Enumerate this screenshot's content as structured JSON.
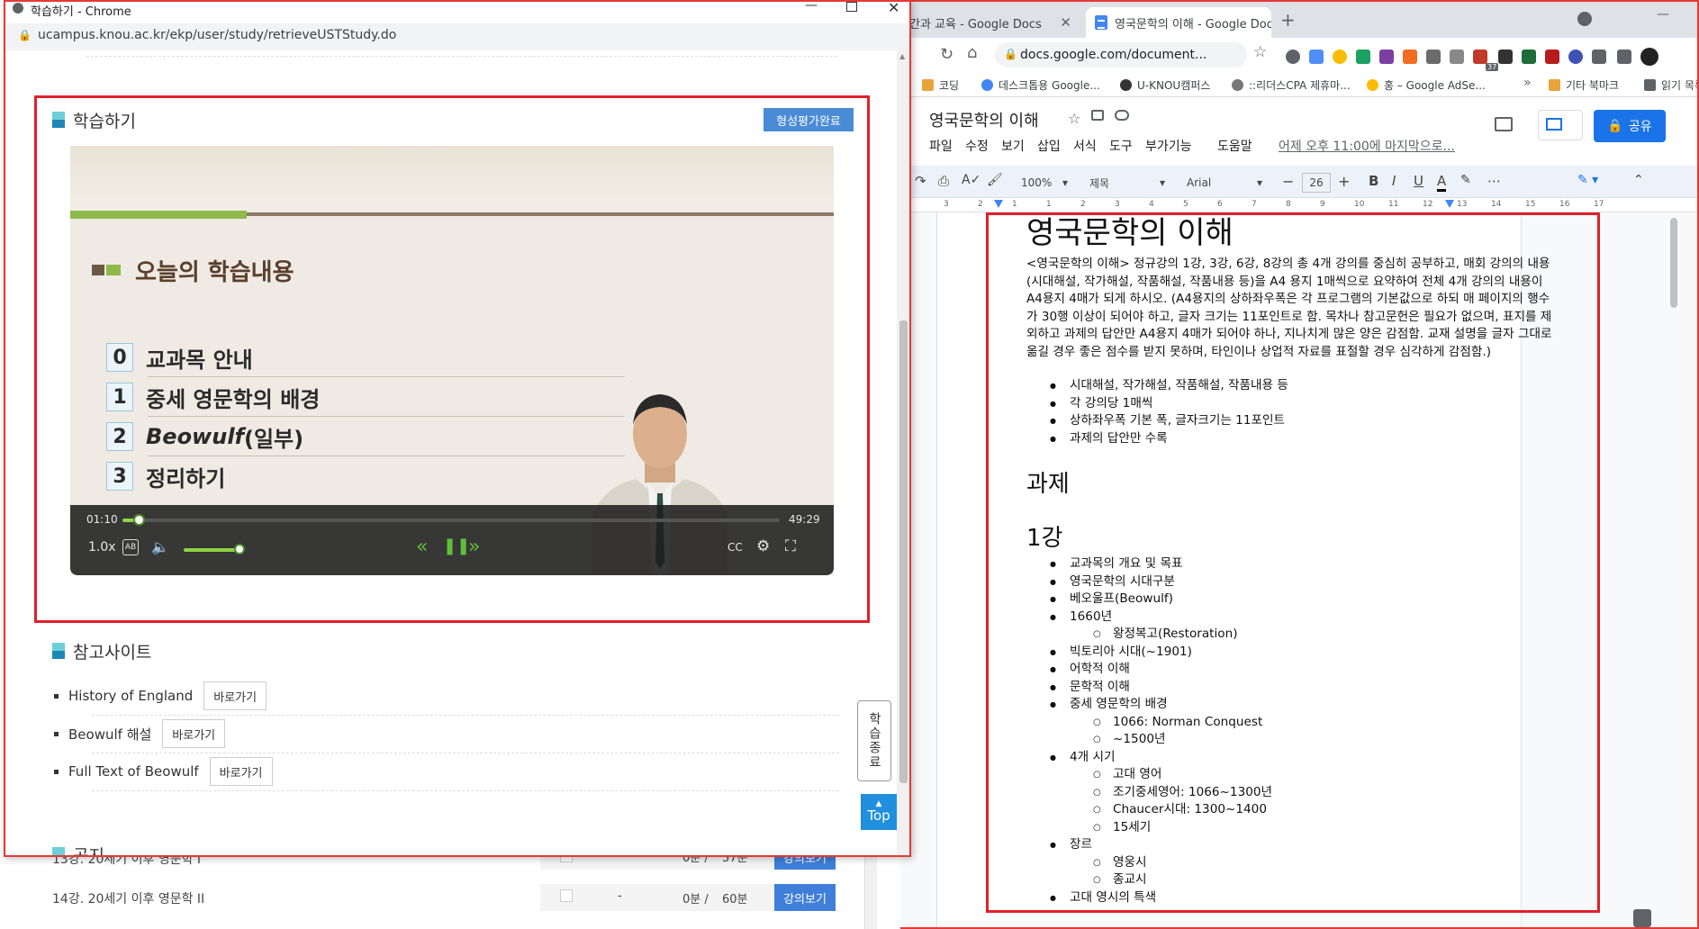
{
  "popup": {
    "title": "학습하기 - Chrome",
    "url": "ucampus.knou.ac.kr/ekp/user/study/retrieveUSTStudy.do",
    "study_section_title": "학습하기",
    "done_button": "형성평가완료",
    "slide": {
      "heading": "오늘의 학습내용",
      "items": [
        {
          "num": "0",
          "label": "교과목 안내"
        },
        {
          "num": "1",
          "label": "중세 영문학의 배경"
        },
        {
          "num": "2",
          "label_italic": "Beowulf",
          "label": " (일부)"
        },
        {
          "num": "3",
          "label": "정리하기"
        }
      ]
    },
    "player": {
      "current_time": "01:10",
      "duration": "49:29",
      "progress": 0.024,
      "speed": "1.0x",
      "volume": 0.75
    },
    "ref_section_title": "참고사이트",
    "ref_links": [
      {
        "label": "History of England",
        "button": "바로가기"
      },
      {
        "label": "Beowulf 해설",
        "button": "바로가기"
      },
      {
        "label": "Full Text of Beowulf",
        "button": "바로가기"
      }
    ],
    "notice_title": "공지",
    "end_study_button": "학습종료",
    "top_button": "Top"
  },
  "background_list": {
    "rows": [
      {
        "title": "13강. 20세기 이후 영문학 I",
        "dash": "-",
        "progress": "0분 /",
        "total": "57분",
        "button": "강의보기"
      },
      {
        "title": "14강. 20세기 이후 영문학 II",
        "dash": "-",
        "progress": "0분 /",
        "total": "60분",
        "button": "강의보기"
      }
    ]
  },
  "browser": {
    "tabs": [
      {
        "label": "간과 교육 - Google Docs"
      },
      {
        "label": "영국문학의 이해 - Google Docs"
      }
    ],
    "omnibox": "docs.google.com/document...",
    "bookmarks": [
      "코딩",
      "데스크톱용 Google...",
      "U-KNOU캠퍼스",
      "::리더스CPA 제휴마...",
      "홍 – Google AdSe...",
      "기타 북마크",
      "읽기 목록"
    ],
    "ext_badge": "37"
  },
  "docs": {
    "title": "영국문학의 이해",
    "menu": [
      "파일",
      "수정",
      "보기",
      "삽입",
      "서식",
      "도구",
      "부가기능",
      "도움말"
    ],
    "last_edit": "어제 오후 11:00에 마지막으로...",
    "share": "공유",
    "toolbar": {
      "zoom": "100%",
      "style": "제목",
      "font": "Arial",
      "font_size": "26"
    },
    "content": {
      "heading": "영국문학의 이해",
      "paragraph": "<영국문학의 이해> 정규강의 1강, 3강, 6강, 8강의 총 4개 강의를 중심히 공부하고, 매회 강의의 내용(시대해설, 작가해설, 작품해설, 작품내용 등)을 A4 용지 1매씩으로 요약하여 전체 4개 강의의 내용이 A4용지 4매가 되게 하시오. (A4용지의 상하좌우폭은 각 프로그램의 기본값으로 하되 매 페이지의 행수가 30행 이상이 되어야 하고, 글자 크기는 11포인트로 함. 목차나 참고문헌은 필요가 없으며, 표지를 제외하고 과제의 답안만 A4용지 4매가 되어야 하나, 지나치게 많은 양은 감점함. 교재 설명을 글자 그대로 옮길 경우 좋은 점수를 받지 못하며, 타인이나 상업적 자료를 표절할 경우 심각하게 감점함.)",
      "bullets1": [
        "시대해설, 작가해설, 작품해설, 작품내용 등",
        "각 강의당 1매씩",
        "상하좌우폭 기본 폭, 글자크기는 11포인트",
        "과제의 답안만 수록"
      ],
      "h_task": "과제",
      "h_lecture1": "1강",
      "lecture1": [
        {
          "t": "교과목의 개요 및 목표",
          "sub": false
        },
        {
          "t": "영국문학의 시대구분",
          "sub": false
        },
        {
          "t": "베오울프(Beowulf)",
          "sub": false
        },
        {
          "t": "1660년",
          "sub": false
        },
        {
          "t": "왕정복고(Restoration)",
          "sub": true
        },
        {
          "t": "빅토리아 시대(~1901)",
          "sub": false
        },
        {
          "t": "어학적 이해",
          "sub": false
        },
        {
          "t": "문학적 이해",
          "sub": false
        },
        {
          "t": "중세 영문학의  배경",
          "sub": false
        },
        {
          "t": "1066: Norman Conquest",
          "sub": true
        },
        {
          "t": "~1500년",
          "sub": true
        },
        {
          "t": "4개 시기",
          "sub": false
        },
        {
          "t": "고대 영어",
          "sub": true
        },
        {
          "t": "조기중세영어: 1066~1300년",
          "sub": true
        },
        {
          "t": "Chaucer시대: 1300~1400",
          "sub": true
        },
        {
          "t": "15세기",
          "sub": true
        },
        {
          "t": "장르",
          "sub": false
        },
        {
          "t": "영웅시",
          "sub": true
        },
        {
          "t": "종교시",
          "sub": true
        },
        {
          "t": "고대 영시의 특색",
          "sub": false
        }
      ]
    }
  }
}
